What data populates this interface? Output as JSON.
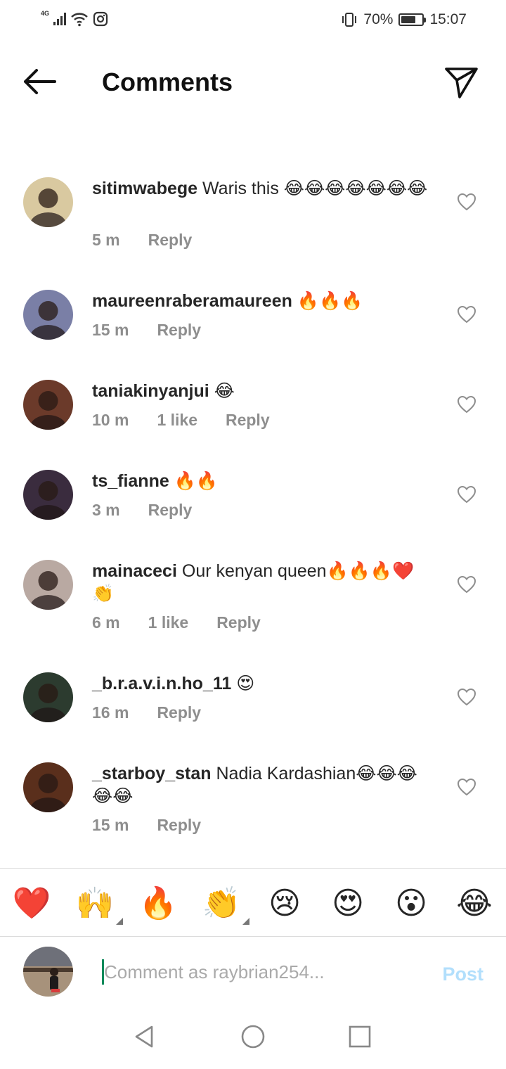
{
  "status_bar": {
    "network": "4G",
    "battery": "70%",
    "battery_level": 0.7,
    "time": "15:07"
  },
  "header": {
    "title": "Comments"
  },
  "comments": [
    {
      "username": "",
      "text": "",
      "time": "10 m",
      "likes": "",
      "reply": "Reply",
      "avatar_color": "#8b2fb8"
    },
    {
      "username": "sitimwabege",
      "text": "Waris this 😂😂😂😂😂😂😂",
      "time": "5 m",
      "likes": "",
      "reply": "Reply",
      "avatar_color": "#d9c9a0"
    },
    {
      "username": "maureenraberamaureen",
      "text": "🔥🔥🔥",
      "time": "15 m",
      "likes": "",
      "reply": "Reply",
      "avatar_color": "#7a7fa6"
    },
    {
      "username": "taniakinyanjui",
      "text": "😂",
      "time": "10 m",
      "likes": "1 like",
      "reply": "Reply",
      "avatar_color": "#6b3a2a"
    },
    {
      "username": "ts_fianne",
      "text": "🔥🔥",
      "time": "3 m",
      "likes": "",
      "reply": "Reply",
      "avatar_color": "#3a2c3e"
    },
    {
      "username": "mainaceci",
      "text": "Our kenyan queen🔥🔥🔥❤️👏",
      "time": "6 m",
      "likes": "1 like",
      "reply": "Reply",
      "avatar_color": "#b9a9a2"
    },
    {
      "username": "_b.r.a.v.i.n.ho_11",
      "text": "😍",
      "time": "16 m",
      "likes": "",
      "reply": "Reply",
      "avatar_color": "#2c3b2f"
    },
    {
      "username": "_starboy_stan",
      "text": "Nadia Kardashian😂😂😂😂😂",
      "time": "15 m",
      "likes": "",
      "reply": "Reply",
      "avatar_color": "#5a2f1c"
    }
  ],
  "reactions": [
    {
      "emoji": "❤️",
      "name": "red-heart",
      "has_more": false
    },
    {
      "emoji": "🙌",
      "name": "raising-hands",
      "has_more": true
    },
    {
      "emoji": "🔥",
      "name": "fire",
      "has_more": false
    },
    {
      "emoji": "👏",
      "name": "clapping-hands",
      "has_more": true
    },
    {
      "emoji": "😢",
      "name": "crying-face",
      "has_more": false
    },
    {
      "emoji": "😍",
      "name": "heart-eyes",
      "has_more": false
    },
    {
      "emoji": "😮",
      "name": "surprised-face",
      "has_more": false
    },
    {
      "emoji": "😂",
      "name": "tears-of-joy",
      "has_more": false
    }
  ],
  "composer": {
    "placeholder": "Comment as raybrian254...",
    "post_label": "Post",
    "avatar_color": "#8a6a50"
  },
  "colors": {
    "post_disabled": "#b2dffc",
    "meta_gray": "#8e8e8e",
    "heart_outline": "#8e8e8e"
  }
}
